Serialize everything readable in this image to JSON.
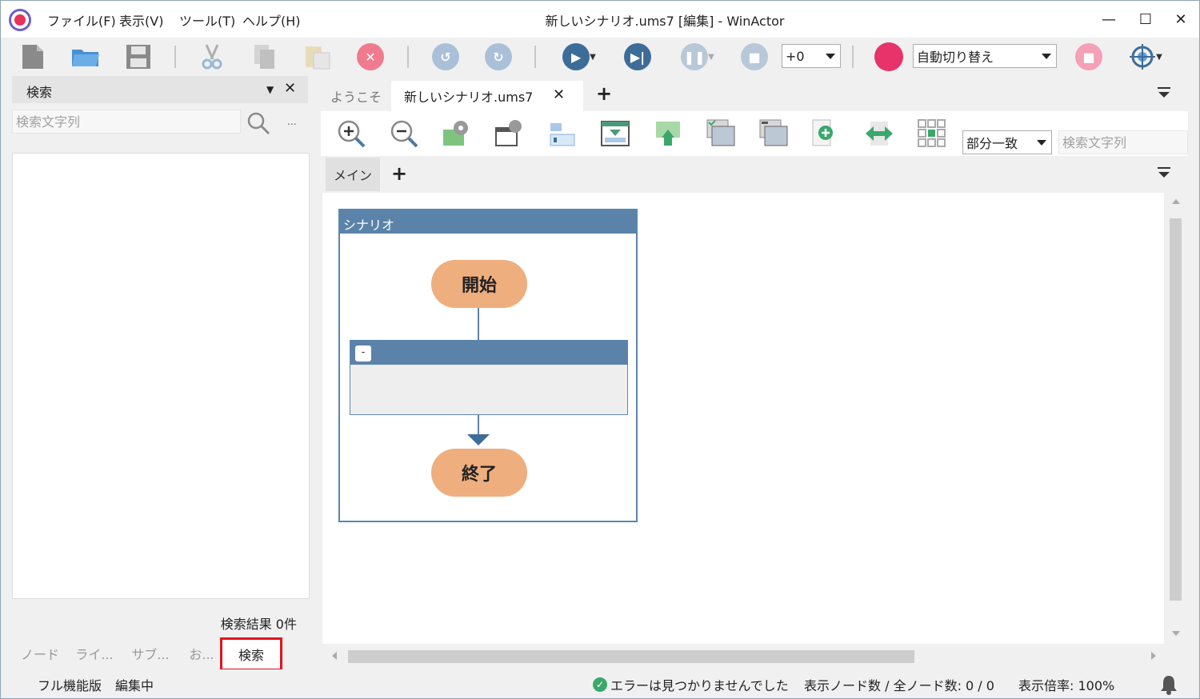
{
  "titlebar": {
    "title": "新しいシナリオ.ums7 [編集] - WinActor",
    "menus": [
      "ファイル(F)",
      "表示(V)",
      "ツール(T)",
      "ヘルプ(H)"
    ],
    "minimize": "—",
    "maximize": "☐",
    "close": "✕"
  },
  "toolbar": {
    "speed_value": "+0",
    "record_mode": "自動切り替え"
  },
  "search_panel": {
    "title": "検索",
    "placeholder": "検索文字列",
    "more": "...",
    "result_count": "検索結果 0件",
    "tabs": [
      "ノード",
      "ライ...",
      "サブ...",
      "お...",
      "検索"
    ]
  },
  "document_tabs": {
    "welcome": "ようこそ",
    "scenario": "新しいシナリオ.ums7",
    "add": "+"
  },
  "flow_toolbar": {
    "match_mode": "部分一致",
    "search_placeholder": "検索文字列"
  },
  "sheet_tabs": {
    "main": "メイン",
    "add": "+"
  },
  "flow": {
    "group_label": "シナリオ",
    "start": "開始",
    "end": "終了",
    "collapse": "-"
  },
  "statusbar": {
    "edition": "フル機能版",
    "mode": "編集中",
    "error_status": "エラーは見つかりませんでした",
    "node_count": "表示ノード数 / 全ノード数: 0 / 0",
    "zoom": "表示倍率: 100%"
  },
  "colors": {
    "accent_blue": "#5b83aa",
    "terminal_orange": "#eeae7e",
    "record_red": "#e8326a",
    "highlight_red": "#e0141e"
  }
}
